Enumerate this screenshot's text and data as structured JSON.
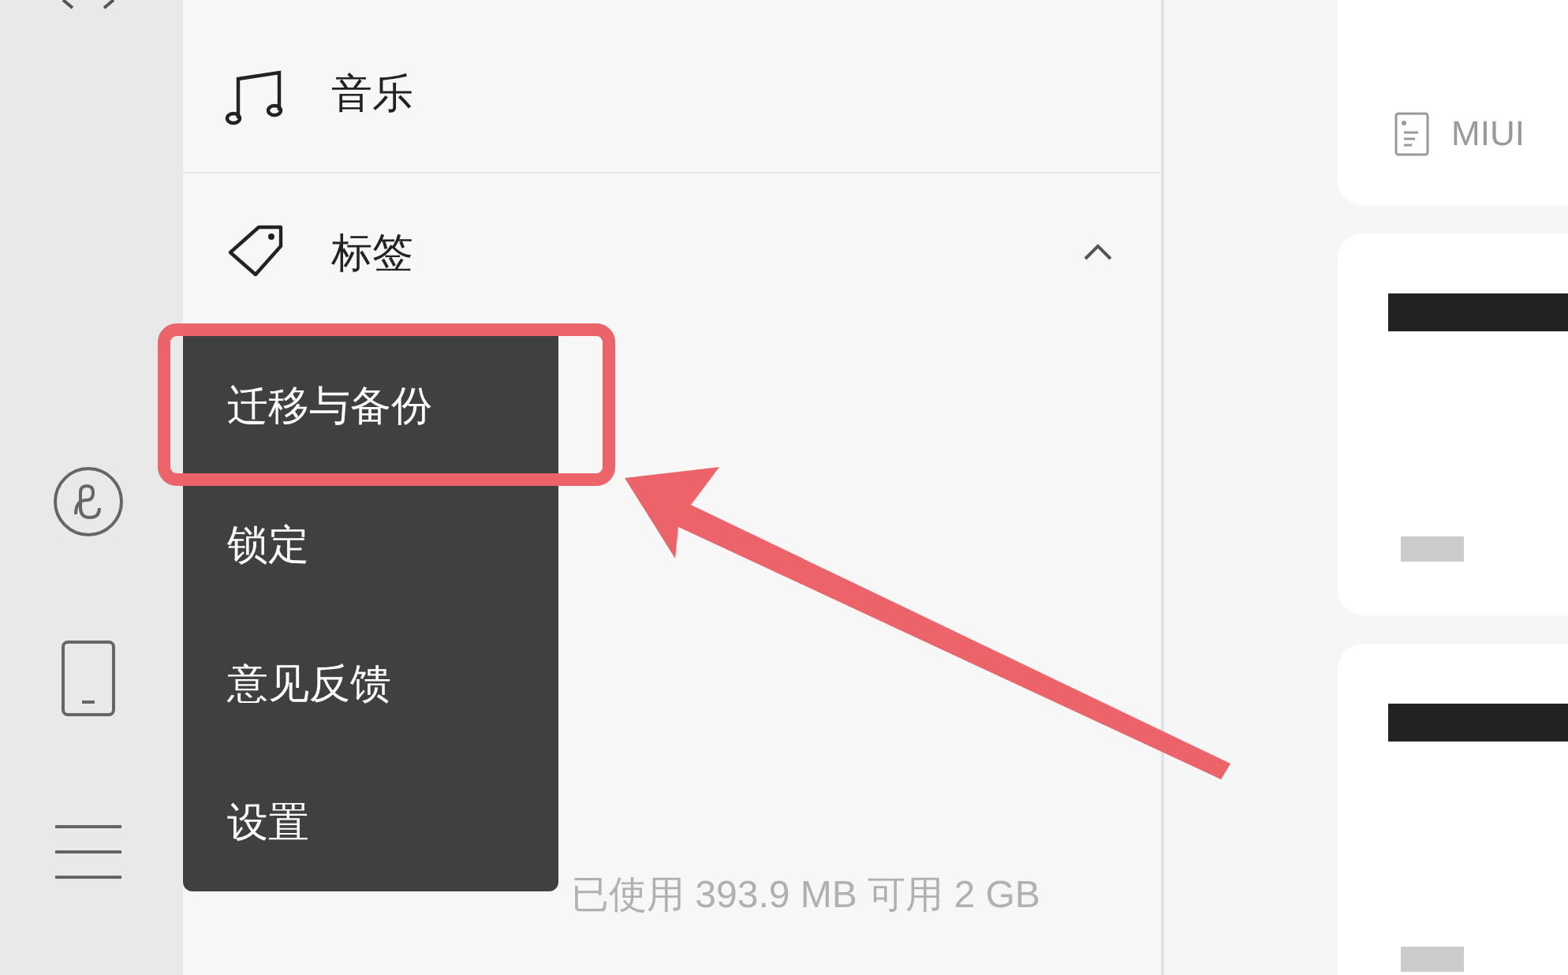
{
  "sidebar": {
    "items": [
      {
        "kind": "music",
        "label": "音乐"
      },
      {
        "kind": "tag",
        "label": "标签",
        "expanded": true
      }
    ],
    "storage": "已使用 393.9 MB 可用 2 GB"
  },
  "menu": {
    "items": [
      {
        "label": "迁移与备份",
        "highlighted": true
      },
      {
        "label": "锁定",
        "highlighted": false
      },
      {
        "label": "意见反馈",
        "highlighted": false
      },
      {
        "label": "设置",
        "highlighted": false
      }
    ]
  },
  "notes": [
    {
      "kind": "folder",
      "folder": "MIUI"
    },
    {
      "kind": "redacted"
    },
    {
      "kind": "redacted"
    }
  ]
}
